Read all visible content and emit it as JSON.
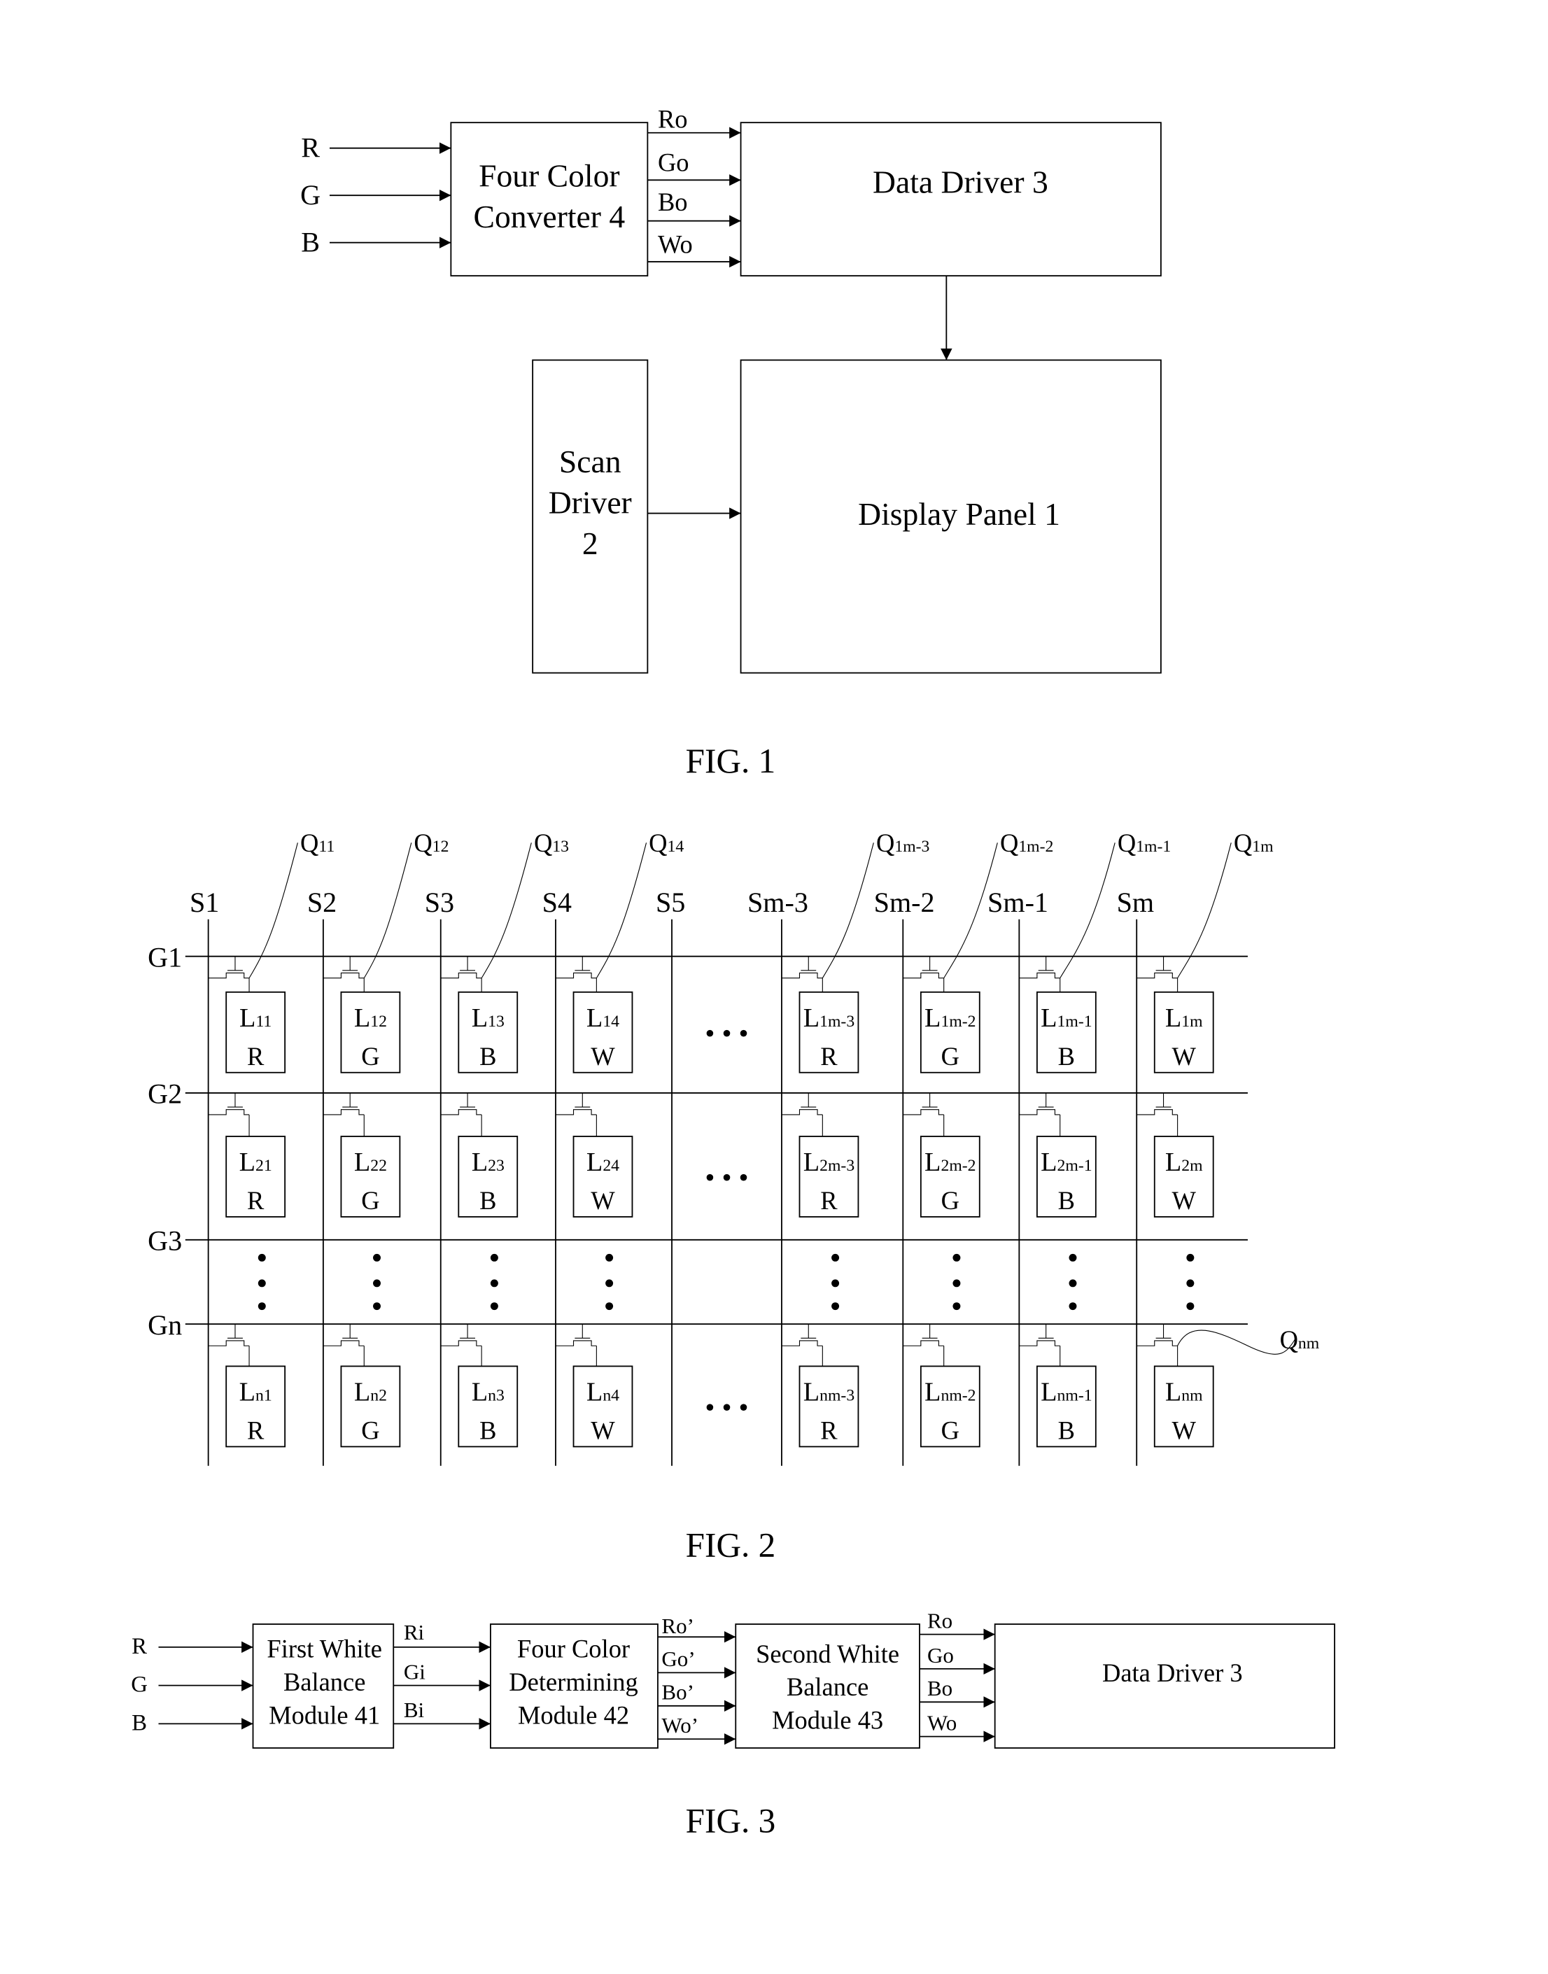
{
  "fig1": {
    "caption": "FIG. 1",
    "inputs": [
      "R",
      "G",
      "B"
    ],
    "converter": [
      "Four Color",
      "Converter 4"
    ],
    "outputs": [
      "Ro",
      "Go",
      "Bo",
      "Wo"
    ],
    "data_driver": "Data Driver 3",
    "scan_driver": [
      "Scan",
      "Driver",
      "2"
    ],
    "display_panel": "Display Panel 1"
  },
  "fig2": {
    "caption": "FIG. 2",
    "source_lines": [
      "S1",
      "S2",
      "S3",
      "S4",
      "S5",
      "Sm-3",
      "Sm-2",
      "Sm-1",
      "Sm"
    ],
    "gate_lines": [
      "G1",
      "G2",
      "G3",
      "Gn"
    ],
    "transistor_labels": [
      "Q11",
      "Q12",
      "Q13",
      "Q14",
      "Q1m-3",
      "Q1m-2",
      "Q1m-1",
      "Q1m"
    ],
    "transistor_label_last": "Qnm",
    "ellipsis": "• • •",
    "rows": [
      {
        "pixels": [
          {
            "id": "L11",
            "color": "R"
          },
          {
            "id": "L12",
            "color": "G"
          },
          {
            "id": "L13",
            "color": "B"
          },
          {
            "id": "L14",
            "color": "W"
          },
          {
            "id": "L1m-3",
            "color": "R"
          },
          {
            "id": "L1m-2",
            "color": "G"
          },
          {
            "id": "L1m-1",
            "color": "B"
          },
          {
            "id": "L1m",
            "color": "W"
          }
        ]
      },
      {
        "pixels": [
          {
            "id": "L21",
            "color": "R"
          },
          {
            "id": "L22",
            "color": "G"
          },
          {
            "id": "L23",
            "color": "B"
          },
          {
            "id": "L24",
            "color": "W"
          },
          {
            "id": "L2m-3",
            "color": "R"
          },
          {
            "id": "L2m-2",
            "color": "G"
          },
          {
            "id": "L2m-1",
            "color": "B"
          },
          {
            "id": "L2m",
            "color": "W"
          }
        ]
      },
      {
        "pixels": [
          {
            "id": "Ln1",
            "color": "R"
          },
          {
            "id": "Ln2",
            "color": "G"
          },
          {
            "id": "Ln3",
            "color": "B"
          },
          {
            "id": "Ln4",
            "color": "W"
          },
          {
            "id": "Lnm-3",
            "color": "R"
          },
          {
            "id": "Lnm-2",
            "color": "G"
          },
          {
            "id": "Lnm-1",
            "color": "B"
          },
          {
            "id": "Lnm",
            "color": "W"
          }
        ]
      }
    ]
  },
  "fig3": {
    "caption": "FIG. 3",
    "inputs": [
      "R",
      "G",
      "B"
    ],
    "module41": [
      "First White",
      "Balance",
      "Module 41"
    ],
    "mid_signals": [
      "Ri",
      "Gi",
      "Bi"
    ],
    "module42": [
      "Four Color",
      "Determining",
      "Module 42"
    ],
    "prime_signals": [
      "Ro’",
      "Go’",
      "Bo’",
      "Wo’"
    ],
    "module43": [
      "Second White",
      "Balance",
      "Module 43"
    ],
    "out_signals": [
      "Ro",
      "Go",
      "Bo",
      "Wo"
    ],
    "data_driver": "Data Driver 3"
  }
}
